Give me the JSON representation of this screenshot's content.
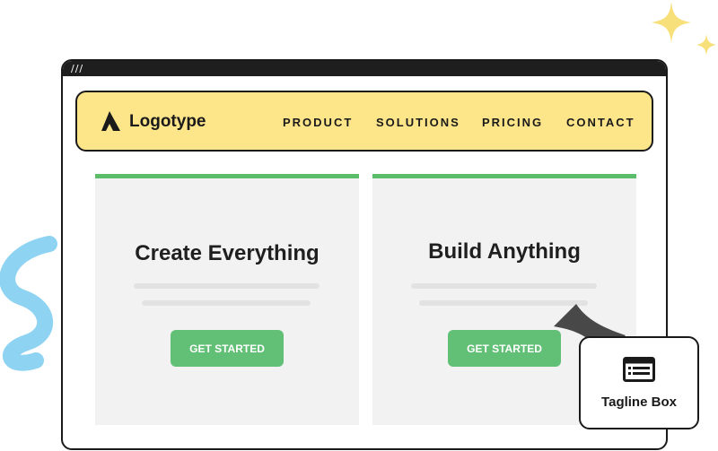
{
  "brand": {
    "name": "Logotype"
  },
  "nav": {
    "items": [
      "PRODUCT",
      "SOLUTIONS",
      "PRICING",
      "CONTACT"
    ]
  },
  "cards": [
    {
      "title": "Create Everything",
      "button": "GET STARTED"
    },
    {
      "title": "Build Anything",
      "button": "GET STARTED"
    }
  ],
  "tagline_box": {
    "label": "Tagline Box",
    "icon": "text-box-icon"
  },
  "colors": {
    "nav_background": "#fde58a",
    "accent_green": "#5bbd6a",
    "button_green": "#62bf76",
    "card_background": "#f2f2f2",
    "sparkle_yellow": "#f7e07a",
    "squiggle_blue": "#8fd3f2"
  }
}
